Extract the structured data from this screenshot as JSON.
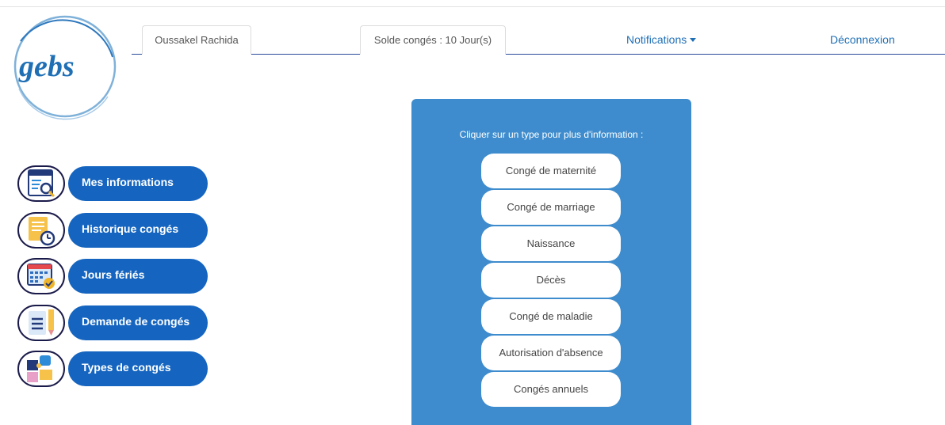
{
  "logo": {
    "text": "gebs"
  },
  "nav": {
    "user_name": "Oussakel Rachida",
    "leave_balance": "Solde congés : 10 Jour(s)",
    "notifications": "Notifications",
    "logout": "Déconnexion"
  },
  "sidebar": {
    "items": [
      {
        "label": "Mes informations",
        "icon": "document-search-icon"
      },
      {
        "label": "Historique congés",
        "icon": "clock-list-icon"
      },
      {
        "label": "Jours fériés",
        "icon": "calendar-check-icon"
      },
      {
        "label": "Demande de congés",
        "icon": "document-pencil-icon"
      },
      {
        "label": "Types de congés",
        "icon": "puzzle-icon"
      }
    ]
  },
  "panel": {
    "hint": "Cliquer sur un type pour plus d'information :",
    "types": [
      "Congé de maternité",
      "Congé de marriage",
      "Naissance",
      "Décès",
      "Congé de maladie",
      "Autorisation d'absence",
      "Congés annuels"
    ]
  },
  "colors": {
    "primary": "#1565c0",
    "panel": "#3e8ccd",
    "link": "#1f6fb5"
  }
}
